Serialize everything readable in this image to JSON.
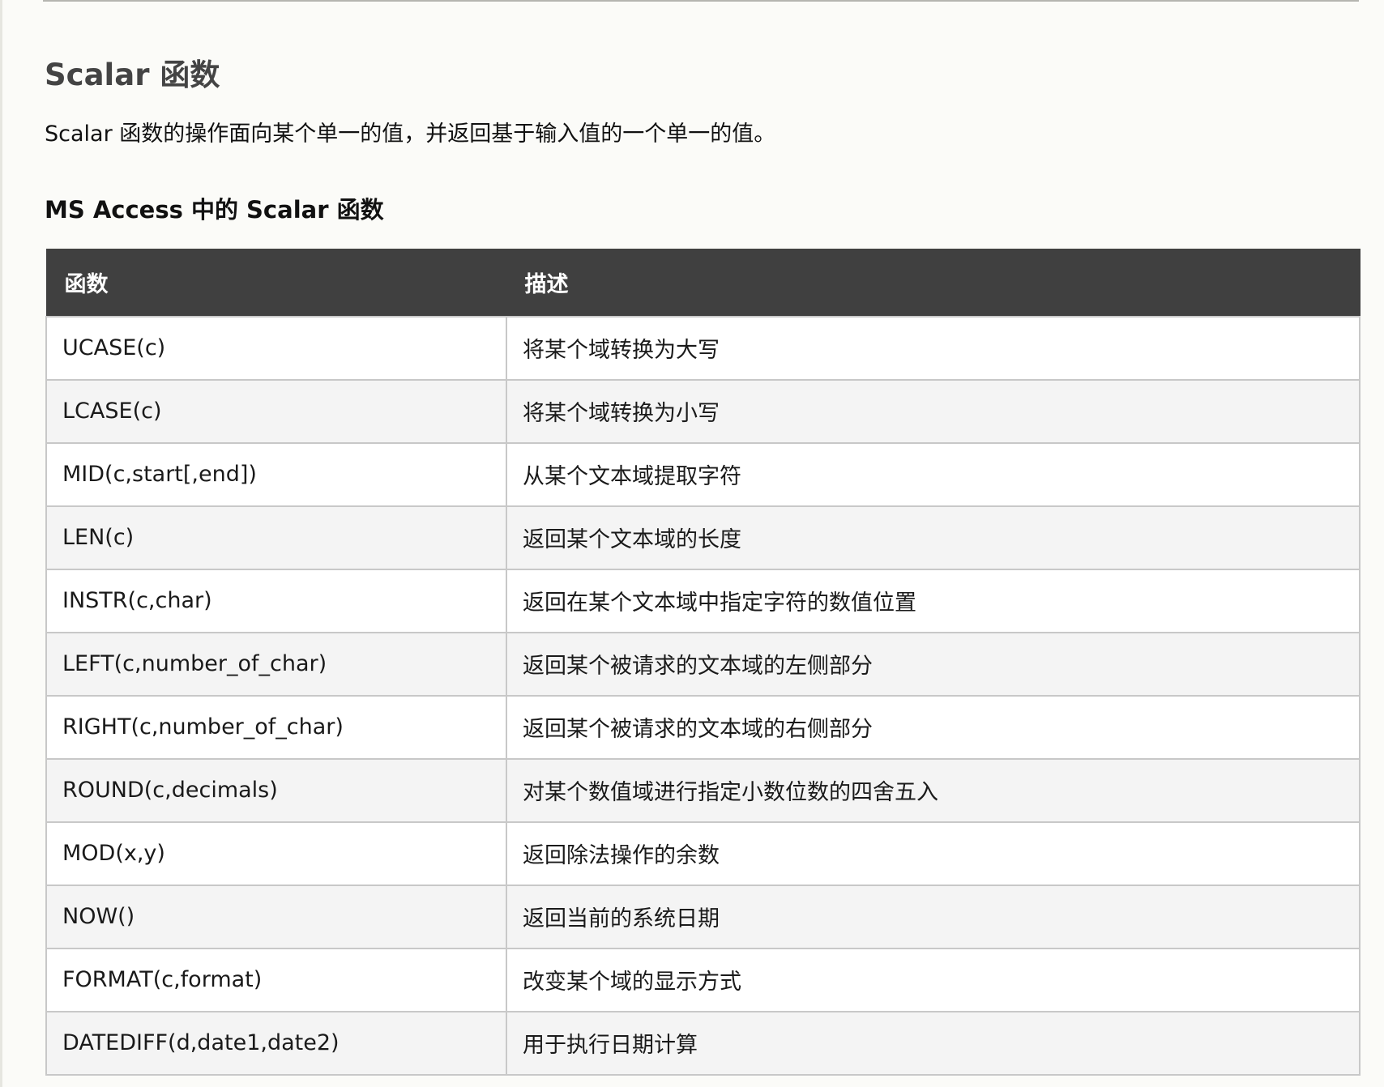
{
  "section_title": "Scalar 函数",
  "intro": "Scalar 函数的操作面向某个单一的值，并返回基于输入值的一个单一的值。",
  "sub_title": "MS Access 中的 Scalar 函数",
  "table": {
    "headers": [
      "函数",
      "描述"
    ],
    "rows": [
      {
        "fn": "UCASE(c)",
        "desc": "将某个域转换为大写"
      },
      {
        "fn": "LCASE(c)",
        "desc": "将某个域转换为小写"
      },
      {
        "fn": "MID(c,start[,end])",
        "desc": "从某个文本域提取字符"
      },
      {
        "fn": "LEN(c)",
        "desc": "返回某个文本域的长度"
      },
      {
        "fn": "INSTR(c,char)",
        "desc": "返回在某个文本域中指定字符的数值位置"
      },
      {
        "fn": "LEFT(c,number_of_char)",
        "desc": "返回某个被请求的文本域的左侧部分"
      },
      {
        "fn": "RIGHT(c,number_of_char)",
        "desc": "返回某个被请求的文本域的右侧部分"
      },
      {
        "fn": "ROUND(c,decimals)",
        "desc": "对某个数值域进行指定小数位数的四舍五入"
      },
      {
        "fn": "MOD(x,y)",
        "desc": "返回除法操作的余数"
      },
      {
        "fn": "NOW()",
        "desc": "返回当前的系统日期"
      },
      {
        "fn": "FORMAT(c,format)",
        "desc": "改变某个域的显示方式"
      },
      {
        "fn": "DATEDIFF(d,date1,date2)",
        "desc": "用于执行日期计算"
      }
    ]
  }
}
